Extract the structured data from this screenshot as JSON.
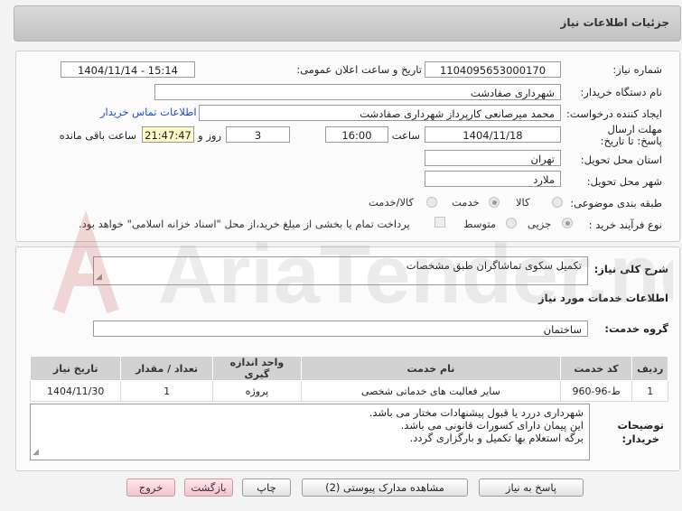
{
  "header": {
    "title": "جزئیات اطلاعات نیاز"
  },
  "fields": {
    "need_number_label": "شماره نیاز:",
    "need_number": "1104095653000170",
    "announce_label": "تاریخ و ساعت اعلان عمومی:",
    "announce_value": "1404/11/14 - 15:14",
    "buyer_org_label": "نام دستگاه خریدار:",
    "buyer_org": "شهرداری صفادشت",
    "creator_label": "ایجاد کننده درخواست:",
    "creator": "محمد میرصانعی کارپرداز شهرداری صفادشت",
    "contact_link": "اطلاعات تماس خریدار",
    "deadline_label": "مهلت ارسال پاسخ: تا تاریخ:",
    "deadline_date": "1404/11/18",
    "time_label": "ساعت",
    "deadline_time": "16:00",
    "days": "3",
    "days_label": "روز و",
    "remaining": "21:47:47",
    "remaining_label": "ساعت باقی مانده",
    "province_label": "استان محل تحویل:",
    "province": "تهران",
    "city_label": "شهر محل تحویل:",
    "city": "ملارد",
    "category_label": "طبقه بندی موضوعی:",
    "category_options": [
      "کالا",
      "خدمت",
      "کالا/خدمت"
    ],
    "process_label": "نوع فرآیند خرید :",
    "process_options": [
      "جزیی",
      "متوسط"
    ],
    "payment_note": "پرداخت تمام یا بخشی از مبلغ خرید،از محل \"اسناد خزانه اسلامی\" خواهد بود."
  },
  "description": {
    "label": "شرح کلی نیاز:",
    "value": "تکمیل سکوی تماشاگران طبق مشخصات"
  },
  "services": {
    "section_title": "اطلاعات خدمات مورد نیاز",
    "group_label": "گروه خدمت:",
    "group_value": "ساختمان",
    "columns": [
      "ردیف",
      "کد خدمت",
      "نام خدمت",
      "واحد اندازه گیری",
      "تعداد / مقدار",
      "تاریخ نیاز"
    ],
    "rows": [
      [
        "1",
        "ط-96-960",
        "سایر فعالیت های خدماتی شخصی",
        "پروژه",
        "1",
        "1404/11/30"
      ]
    ]
  },
  "notes": {
    "label_line1": "توضیحات",
    "label_line2": "خریدار:",
    "lines": [
      "شهرداری دررد یا قبول پیشنهادات مختار می باشد.",
      "این پیمان دارای کسورات قانونی می باشد.",
      "برگه استعلام بها تکمیل و بارگزاری گردد."
    ]
  },
  "buttons": {
    "reply": "پاسخ به نیاز",
    "attachments": "مشاهده مدارک پیوستی (2)",
    "print": "چاپ",
    "back": "بازگشت",
    "exit": "خروج"
  },
  "watermark": {
    "text": "AriaTender.net"
  }
}
